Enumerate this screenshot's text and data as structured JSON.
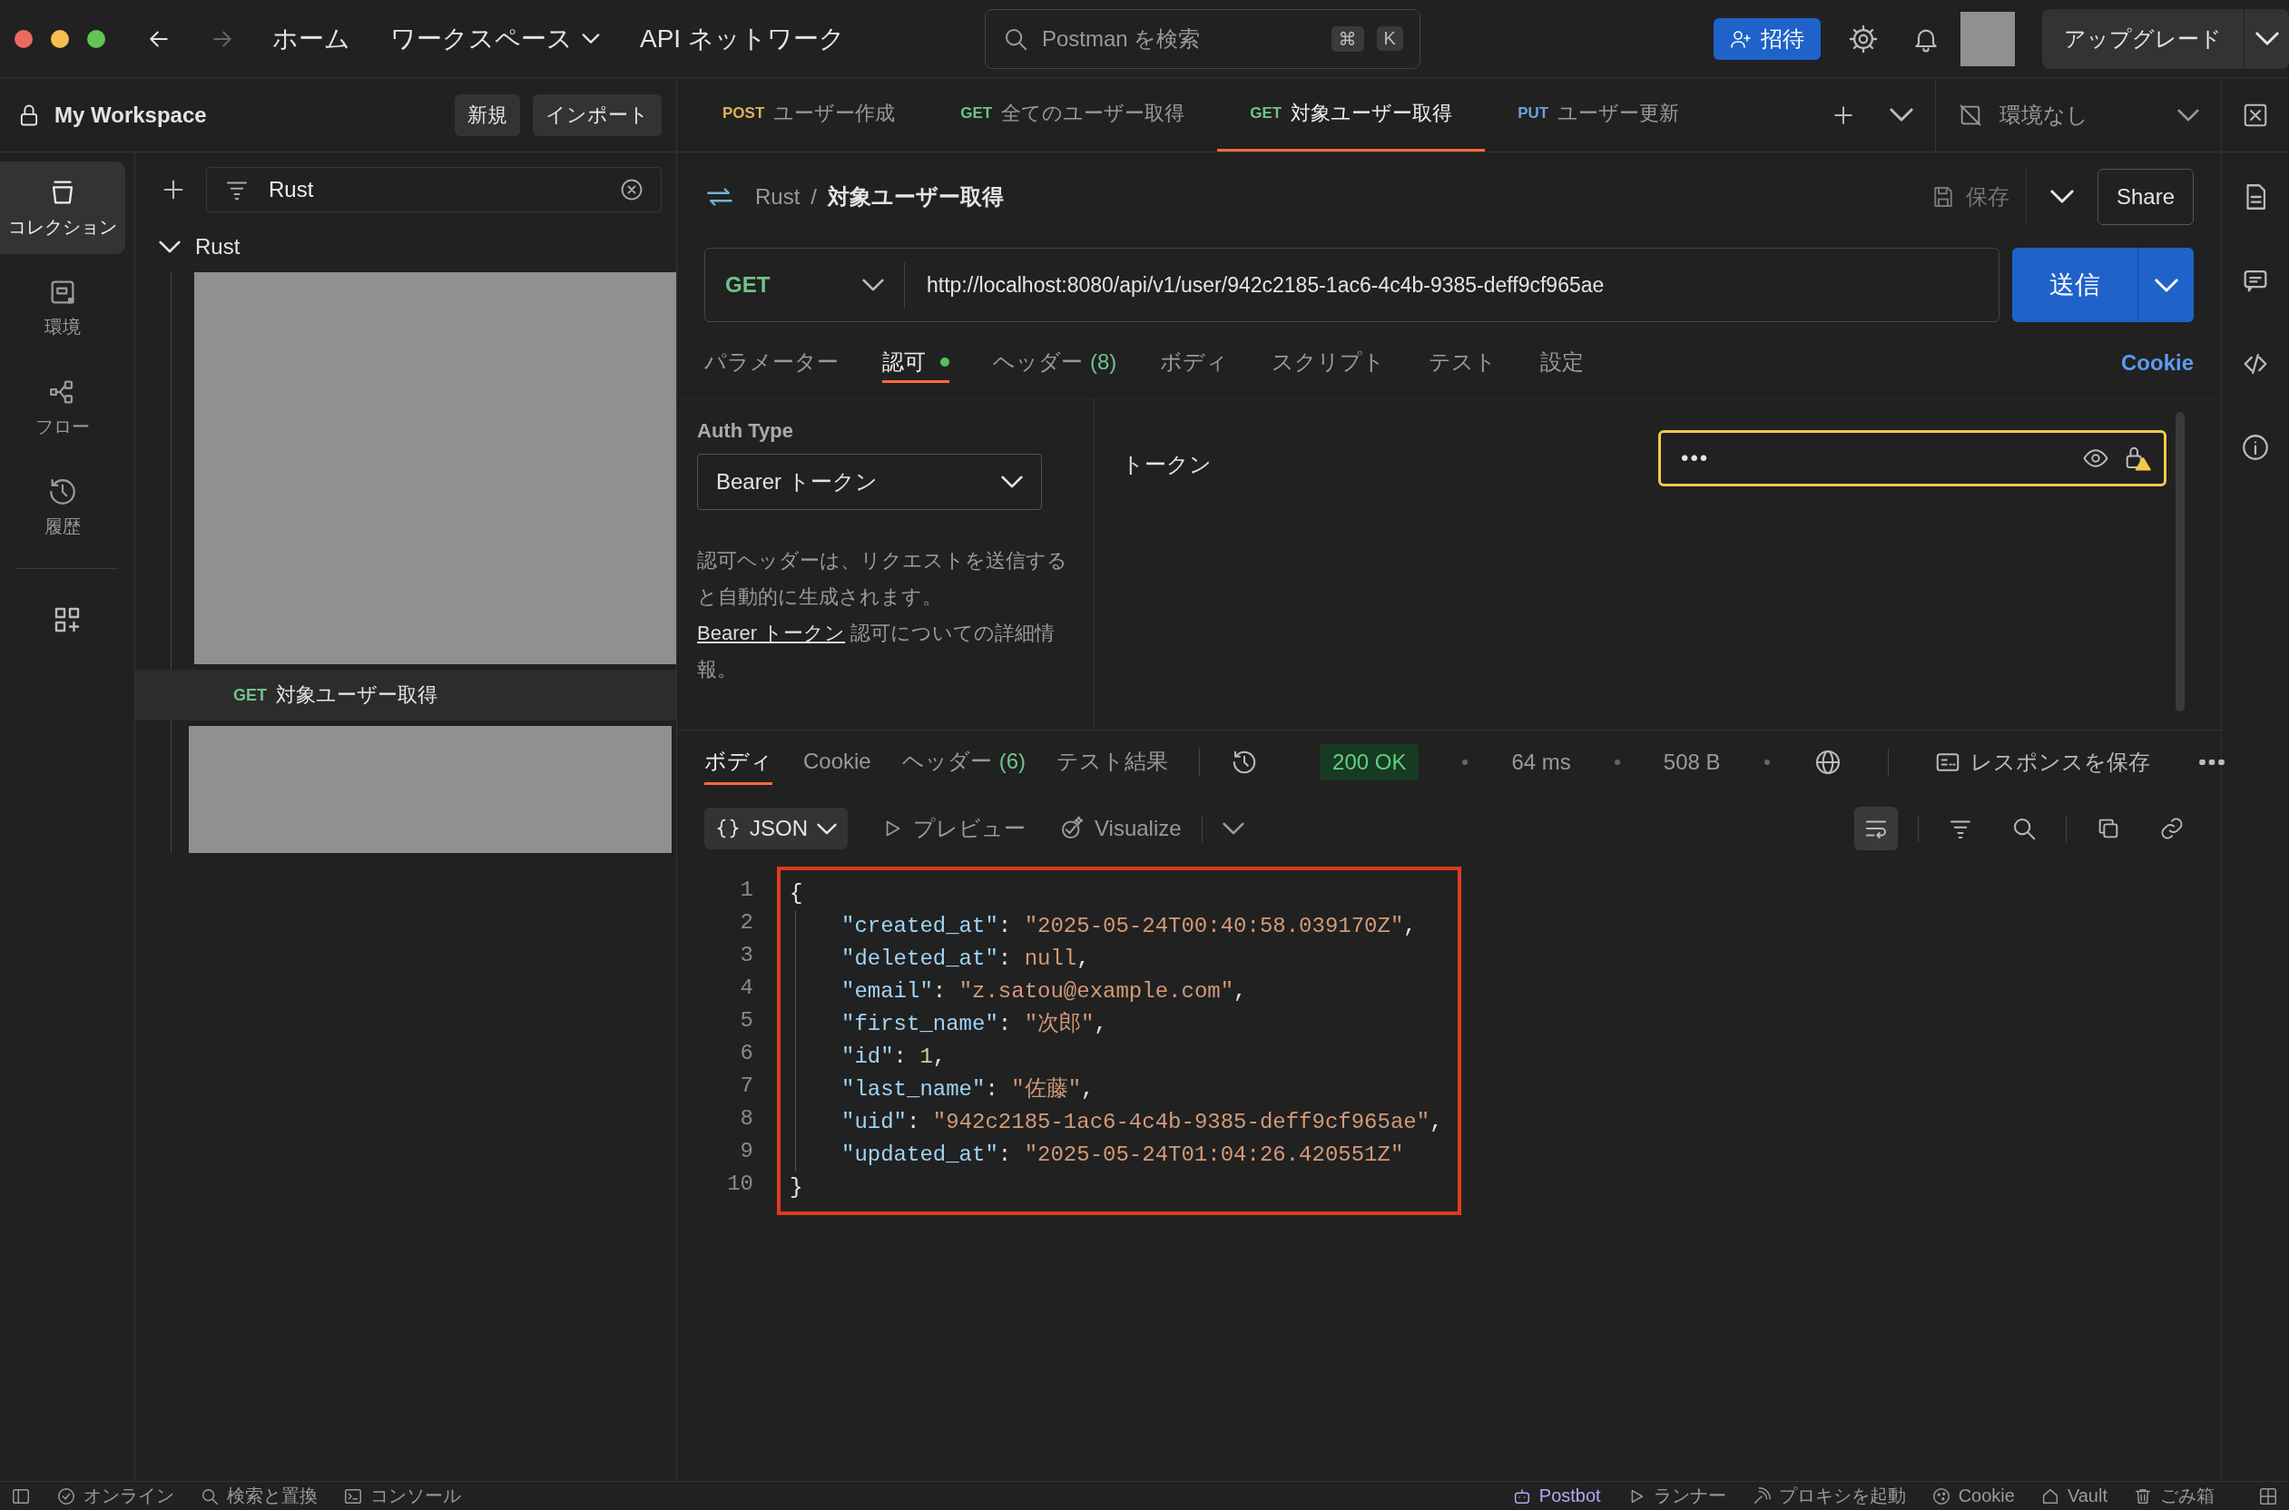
{
  "topbar": {
    "nav": [
      {
        "label": "ホーム",
        "dropdown": false
      },
      {
        "label": "ワークスペース",
        "dropdown": true
      },
      {
        "label": "API ネットワーク",
        "dropdown": false
      }
    ],
    "search": {
      "placeholder": "Postman を検索",
      "keys": [
        "⌘",
        "K"
      ]
    },
    "invite": "招待",
    "upgrade": "アップグレード"
  },
  "workspace": {
    "name": "My Workspace",
    "buttons": [
      "新規",
      "インポート"
    ]
  },
  "request_tabs": [
    {
      "method": "POST",
      "color": "#d9b45a",
      "label": "ユーザー作成",
      "selected": false
    },
    {
      "method": "GET",
      "color": "#6fc48a",
      "label": "全てのユーザー取得",
      "selected": false
    },
    {
      "method": "GET",
      "color": "#6fc48a",
      "label": "対象ユーザー取得",
      "selected": true
    },
    {
      "method": "PUT",
      "color": "#6f9fe0",
      "label": "ユーザー更新",
      "selected": false
    }
  ],
  "environment": "環境なし",
  "rail": [
    {
      "label": "コレクション",
      "selected": true
    },
    {
      "label": "環境",
      "selected": false
    },
    {
      "label": "フロー",
      "selected": false
    },
    {
      "label": "履歴",
      "selected": false
    }
  ],
  "sidebar": {
    "filter": "Rust",
    "tree": [
      {
        "name": "Rust",
        "expanded": true,
        "children": [
          {
            "kind": "redacted"
          },
          {
            "kind": "request",
            "method": "GET",
            "color": "#6fc48a",
            "name": "対象ユーザー取得",
            "selected": true
          },
          {
            "kind": "redacted"
          }
        ]
      }
    ]
  },
  "request": {
    "breadcrumb": [
      "Rust",
      "/",
      "対象ユーザー取得"
    ],
    "save": "保存",
    "share": "Share",
    "method": {
      "label": "GET",
      "color": "#6fc48a"
    },
    "url": "http://localhost:8080/api/v1/user/942c2185-1ac6-4c4b-9385-deff9cf965ae",
    "send": "送信",
    "tabs": [
      {
        "label": "パラメーター",
        "selected": false
      },
      {
        "label": "認可",
        "selected": true,
        "indicator": true
      },
      {
        "label": "ヘッダー",
        "count": "(8)",
        "selected": false
      },
      {
        "label": "ボディ",
        "selected": false
      },
      {
        "label": "スクリプト",
        "selected": false
      },
      {
        "label": "テスト",
        "selected": false
      },
      {
        "label": "設定",
        "selected": false
      }
    ],
    "cookie_link": "Cookie",
    "auth": {
      "label": "Auth Type",
      "type": "Bearer トークン",
      "help": "認可ヘッダーは、リクエストを送信すると自動的に生成されます。",
      "link": "Bearer トークン",
      "help_after": " 認可についての詳細情報。",
      "token_label": "トークン",
      "token_value": "•••"
    }
  },
  "response": {
    "tabs": [
      {
        "label": "ボディ",
        "selected": true
      },
      {
        "label": "Cookie",
        "selected": false
      },
      {
        "label": "ヘッダー",
        "count": "(6)",
        "selected": false
      },
      {
        "label": "テスト結果",
        "selected": false
      }
    ],
    "status": "200 OK",
    "time": "64 ms",
    "size": "508 B",
    "save_response": "レスポンスを保存",
    "format": "JSON",
    "preview": "プレビュー",
    "visualize": "Visualize",
    "wrap_on": true,
    "highlighted": true,
    "lines": [
      {
        "number": "1",
        "text": "{",
        "indented": false
      },
      {
        "number": "2",
        "text": "\"created_at\": \"2025-05-24T00:40:58.039170Z\",",
        "indented": true
      },
      {
        "number": "3",
        "text": "\"deleted_at\": null,",
        "indented": true
      },
      {
        "number": "4",
        "text": "\"email\": \"z.satou@example.com\",",
        "indented": true
      },
      {
        "number": "5",
        "text": "\"first_name\": \"次郎\",",
        "indented": true
      },
      {
        "number": "6",
        "text": "\"id\": 1,",
        "indented": true
      },
      {
        "number": "7",
        "text": "\"last_name\": \"佐藤\",",
        "indented": true
      },
      {
        "number": "8",
        "text": "\"uid\": \"942c2185-1ac6-4c4b-9385-deff9cf965ae\",",
        "indented": true
      },
      {
        "number": "9",
        "text": "\"updated_at\": \"2025-05-24T01:04:26.420551Z\"",
        "indented": true
      },
      {
        "number": "10",
        "text": "}",
        "indented": false
      }
    ]
  },
  "status_bar": {
    "left": [
      "オンライン",
      "検索と置換",
      "コンソール"
    ],
    "right": [
      "Postbot",
      "ランナー",
      "プロキシを起動",
      "Cookie",
      "Vault",
      "ごみ箱"
    ]
  }
}
